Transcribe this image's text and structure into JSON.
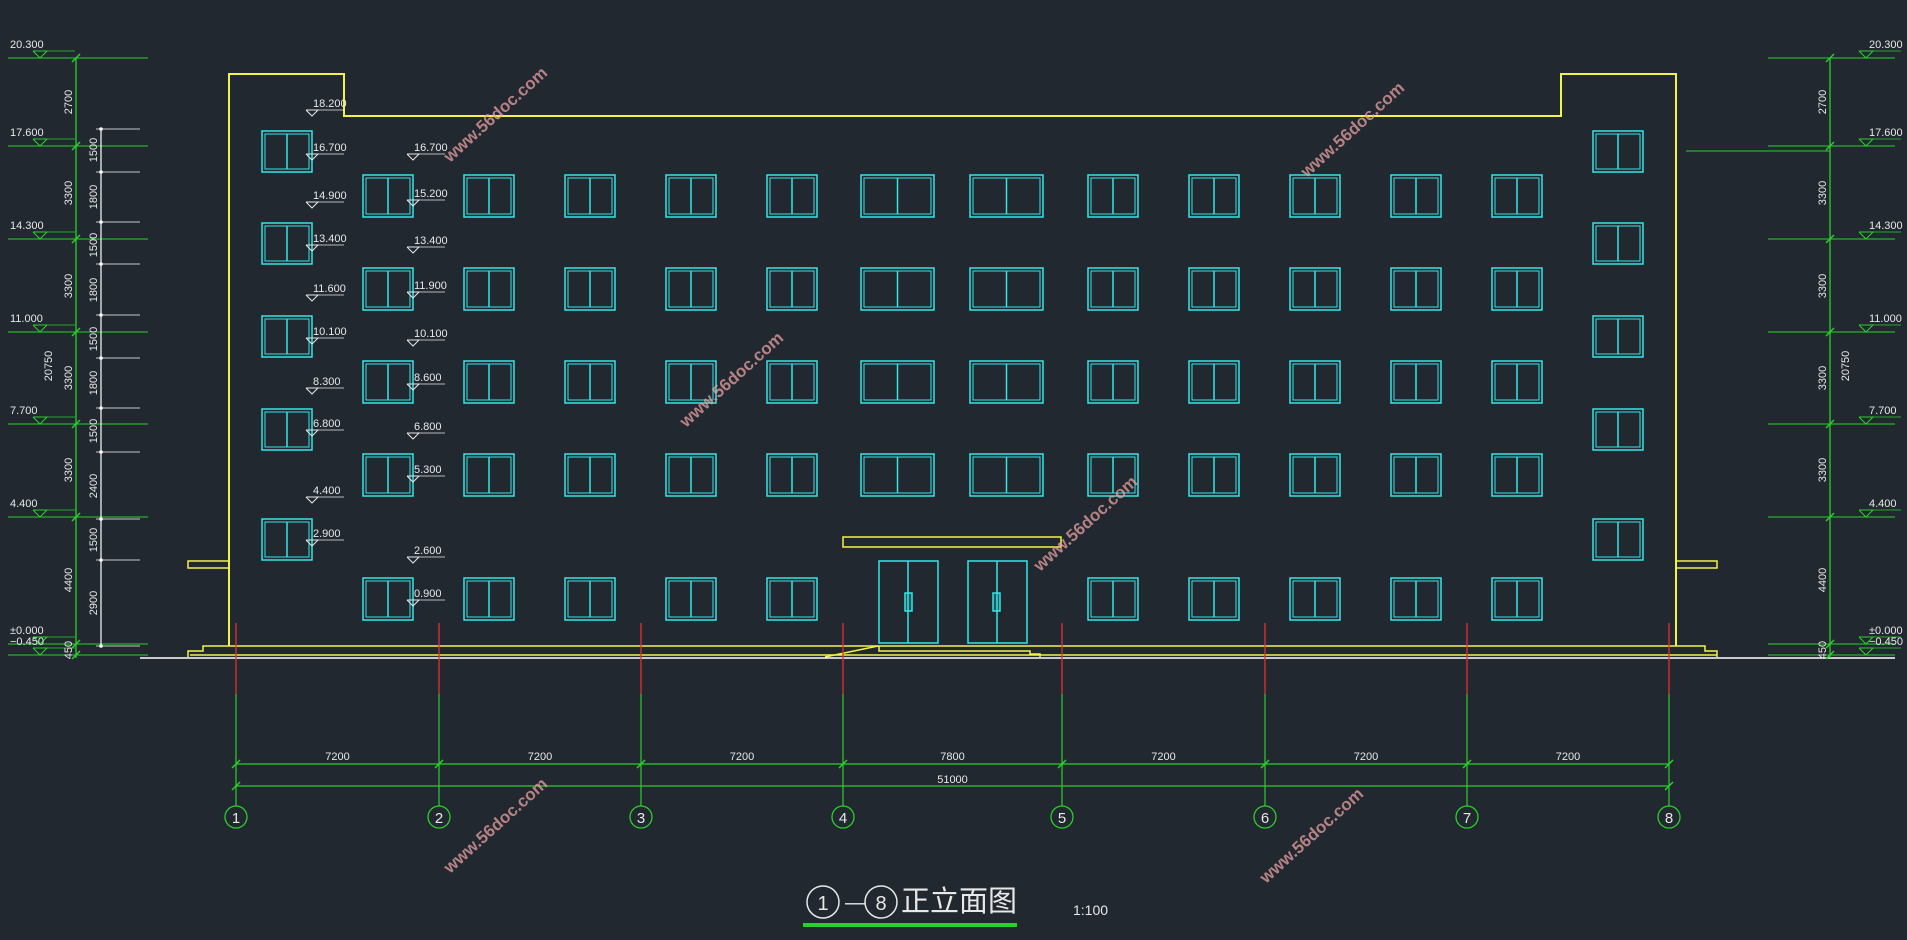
{
  "title": {
    "start_axis": "1",
    "dash": "—",
    "end_axis": "8",
    "name": "正立面图",
    "scale": "1:100"
  },
  "elevations_left": [
    "20.300",
    "17.600",
    "14.300",
    "11.000",
    "7.700",
    "4.400",
    "±0.000",
    "−0.450"
  ],
  "elevations_right": [
    "20.300",
    "17.600",
    "14.300",
    "11.000",
    "7.700",
    "4.400",
    "±0.000",
    "−0.450"
  ],
  "dims_left_outer": [
    "2700",
    "3300",
    "3300",
    "3300",
    "3300",
    "4400",
    "450"
  ],
  "dims_left_inner": [
    "1500",
    "1800",
    "1500",
    "1800",
    "1500",
    "1800",
    "1500",
    "2400",
    "1500",
    "2900"
  ],
  "dims_right": [
    "2700",
    "3300",
    "3300",
    "3300",
    "3300",
    "4400",
    "450"
  ],
  "total_height_left": "20750",
  "total_height_right": "20750",
  "window_levels": [
    "18.200",
    "16.700",
    "16.700",
    "15.200",
    "14.900",
    "13.400",
    "13.400",
    "11.900",
    "11.600",
    "10.100",
    "10.100",
    "8.600",
    "8.300",
    "6.800",
    "6.800",
    "5.300",
    "4.400",
    "2.900",
    "2.600",
    "0.900"
  ],
  "axes": [
    "1",
    "2",
    "3",
    "4",
    "5",
    "6",
    "7",
    "8"
  ],
  "bay_spacings": [
    "7200",
    "7200",
    "7200",
    "7800",
    "7200",
    "7200",
    "7200"
  ],
  "overall_length": "51000",
  "watermark": "www.56doc.com",
  "colors": {
    "background": "#212830",
    "outline": "#f2f24a",
    "window": "#32e6e6",
    "dimension": "#2ad02a",
    "text": "#e8e8e8",
    "axis_tick": "#e03030",
    "watermark": "#e8a0a0"
  }
}
